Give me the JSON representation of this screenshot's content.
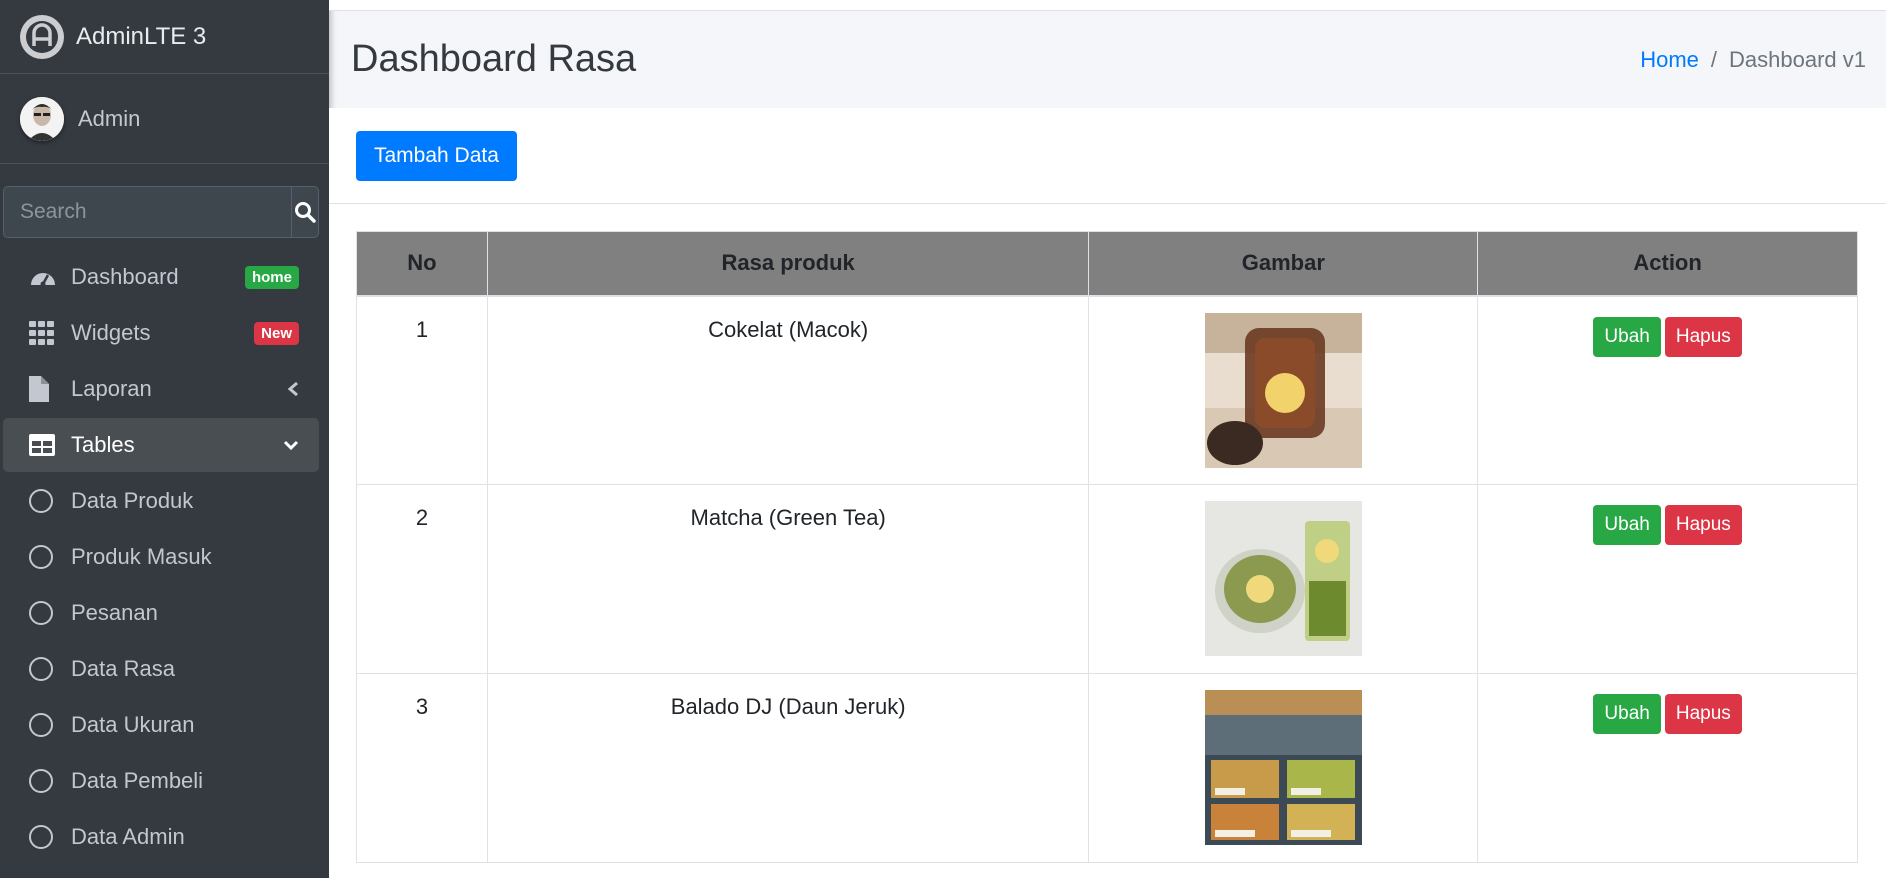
{
  "brand": {
    "name": "AdminLTE 3"
  },
  "user": {
    "name": "Admin"
  },
  "search": {
    "placeholder": "Search"
  },
  "sidebar": {
    "items": [
      {
        "label": "Dashboard",
        "icon": "tachometer-icon",
        "badge": "home",
        "badge_color": "#28a745"
      },
      {
        "label": "Widgets",
        "icon": "grid-icon",
        "badge": "New",
        "badge_color": "#dc3545"
      },
      {
        "label": "Laporan",
        "icon": "file-icon"
      },
      {
        "label": "Tables",
        "icon": "table-icon",
        "active": true
      },
      {
        "label": "Data Produk",
        "icon": "circle-icon"
      },
      {
        "label": "Produk Masuk",
        "icon": "circle-icon"
      },
      {
        "label": "Pesanan",
        "icon": "circle-icon"
      },
      {
        "label": "Data Rasa",
        "icon": "circle-icon"
      },
      {
        "label": "Data Ukuran",
        "icon": "circle-icon"
      },
      {
        "label": "Data Pembeli",
        "icon": "circle-icon"
      },
      {
        "label": "Data Admin",
        "icon": "circle-icon"
      }
    ]
  },
  "header": {
    "title": "Dashboard Rasa",
    "breadcrumb": {
      "home": "Home",
      "separator": "/",
      "current": "Dashboard v1"
    }
  },
  "card": {
    "add_button": "Tambah Data"
  },
  "table": {
    "columns": [
      "No",
      "Rasa produk",
      "Gambar",
      "Action"
    ],
    "rows": [
      {
        "no": "1",
        "rasa": "Cokelat (Macok)",
        "image": "cokelat-product-photo"
      },
      {
        "no": "2",
        "rasa": "Matcha (Green Tea)",
        "image": "matcha-product-photo"
      },
      {
        "no": "3",
        "rasa": "Balado DJ (Daun Jeruk)",
        "image": "balado-product-photo"
      }
    ],
    "edit_label": "Ubah",
    "delete_label": "Hapus"
  },
  "colors": {
    "sidebar_bg": "#343a40",
    "primary": "#007bff",
    "success": "#28a745",
    "danger": "#dc3545",
    "table_header_bg": "#808080"
  }
}
